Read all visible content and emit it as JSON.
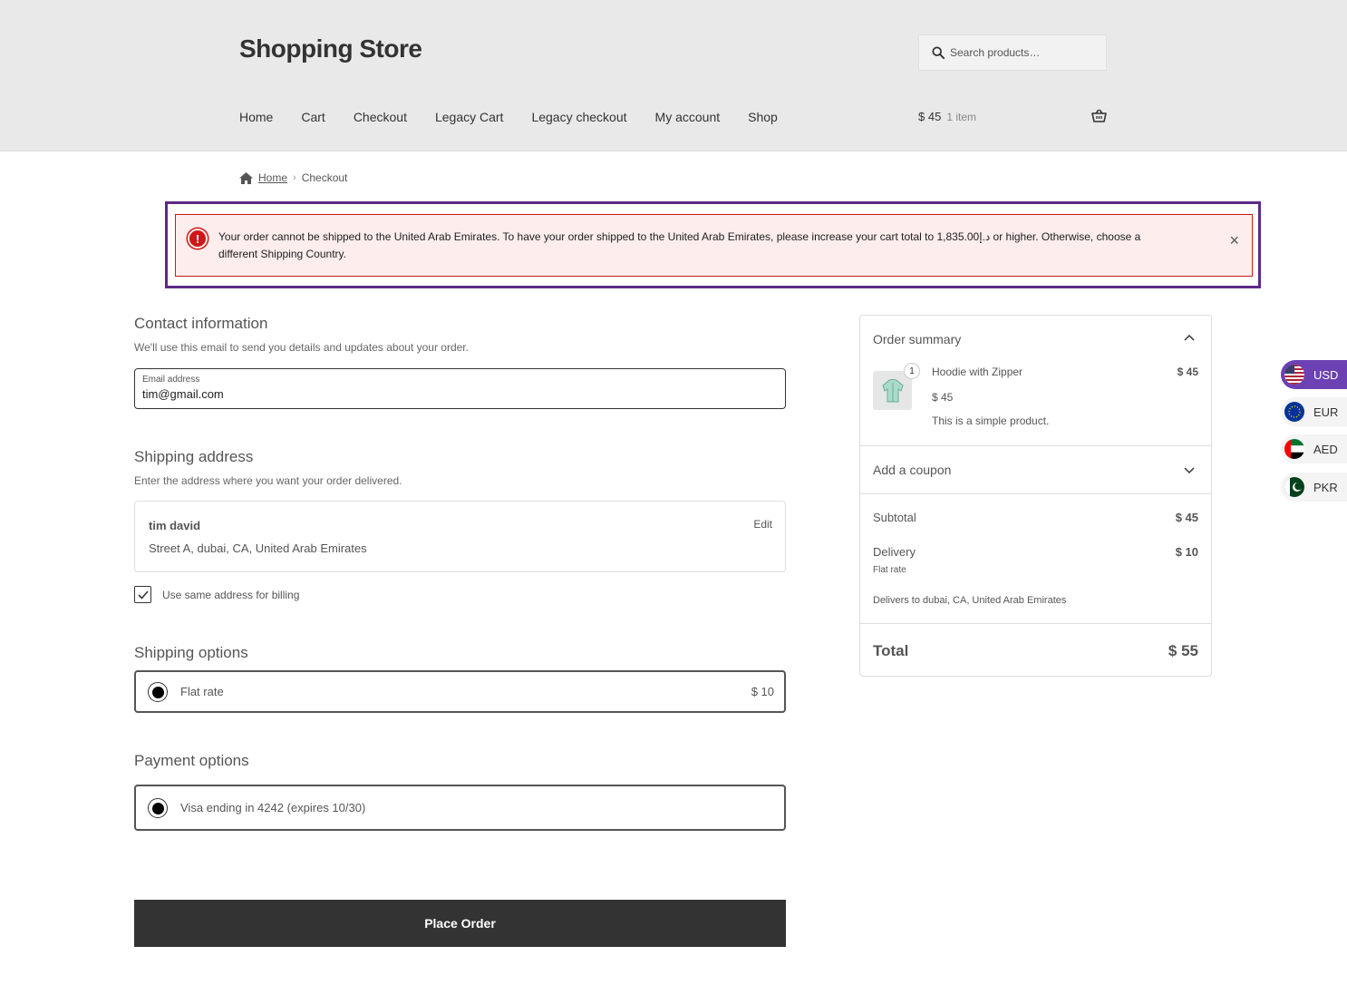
{
  "header": {
    "brand": "Shopping Store",
    "search_placeholder": "Search products…",
    "nav": [
      "Home",
      "Cart",
      "Checkout",
      "Legacy Cart",
      "Legacy checkout",
      "My account",
      "Shop"
    ],
    "cart_total": "$ 45",
    "cart_count": "1 item"
  },
  "breadcrumb": {
    "home": "Home",
    "current": "Checkout"
  },
  "notice": {
    "message": "Your order cannot be shipped to the United Arab Emirates. To have your order shipped to the United Arab Emirates, please increase your cart total to 1,835.00د.إ or higher. Otherwise, choose a different Shipping Country.",
    "close_symbol": "×",
    "icon_symbol": "!"
  },
  "contact": {
    "title": "Contact information",
    "description": "We'll use this email to send you details and updates about your order.",
    "email_label": "Email address",
    "email_value": "tim@gmail.com"
  },
  "shipping_address": {
    "title": "Shipping address",
    "description": "Enter the address where you want your order delivered.",
    "name": "tim david",
    "address": "Street A, dubai, CA, United Arab Emirates",
    "edit_label": "Edit",
    "same_billing_label": "Use same address for billing",
    "same_billing_checked": true
  },
  "shipping_options": {
    "title": "Shipping options",
    "option_label": "Flat rate",
    "option_price": "$ 10"
  },
  "payment_options": {
    "title": "Payment options",
    "option_label": "Visa ending in 4242 (expires 10/30)"
  },
  "place_order_label": "Place Order",
  "summary": {
    "title": "Order summary",
    "item": {
      "quantity": "1",
      "name": "Hoodie with Zipper",
      "line_price": "$ 45",
      "unit_price": "$ 45",
      "description": "This is a simple product."
    },
    "coupon_label": "Add a coupon",
    "subtotal_label": "Subtotal",
    "subtotal_value": "$ 45",
    "delivery_label": "Delivery",
    "delivery_value": "$ 10",
    "delivery_method": "Flat rate",
    "delivers_to": "Delivers to dubai, CA, United Arab Emirates",
    "total_label": "Total",
    "total_value": "$ 55"
  },
  "currencies": [
    {
      "code": "USD",
      "active": true,
      "flag": "us-flag-icon"
    },
    {
      "code": "EUR",
      "active": false,
      "flag": "eu-flag-icon"
    },
    {
      "code": "AED",
      "active": false,
      "flag": "ae-flag-icon"
    },
    {
      "code": "PKR",
      "active": false,
      "flag": "pk-flag-icon"
    }
  ],
  "colors": {
    "accent": "#6c41b3",
    "error": "#cc1818",
    "notice_bg": "#fdeded",
    "highlight_border": "#5b2a86",
    "button_bg": "#333333"
  }
}
